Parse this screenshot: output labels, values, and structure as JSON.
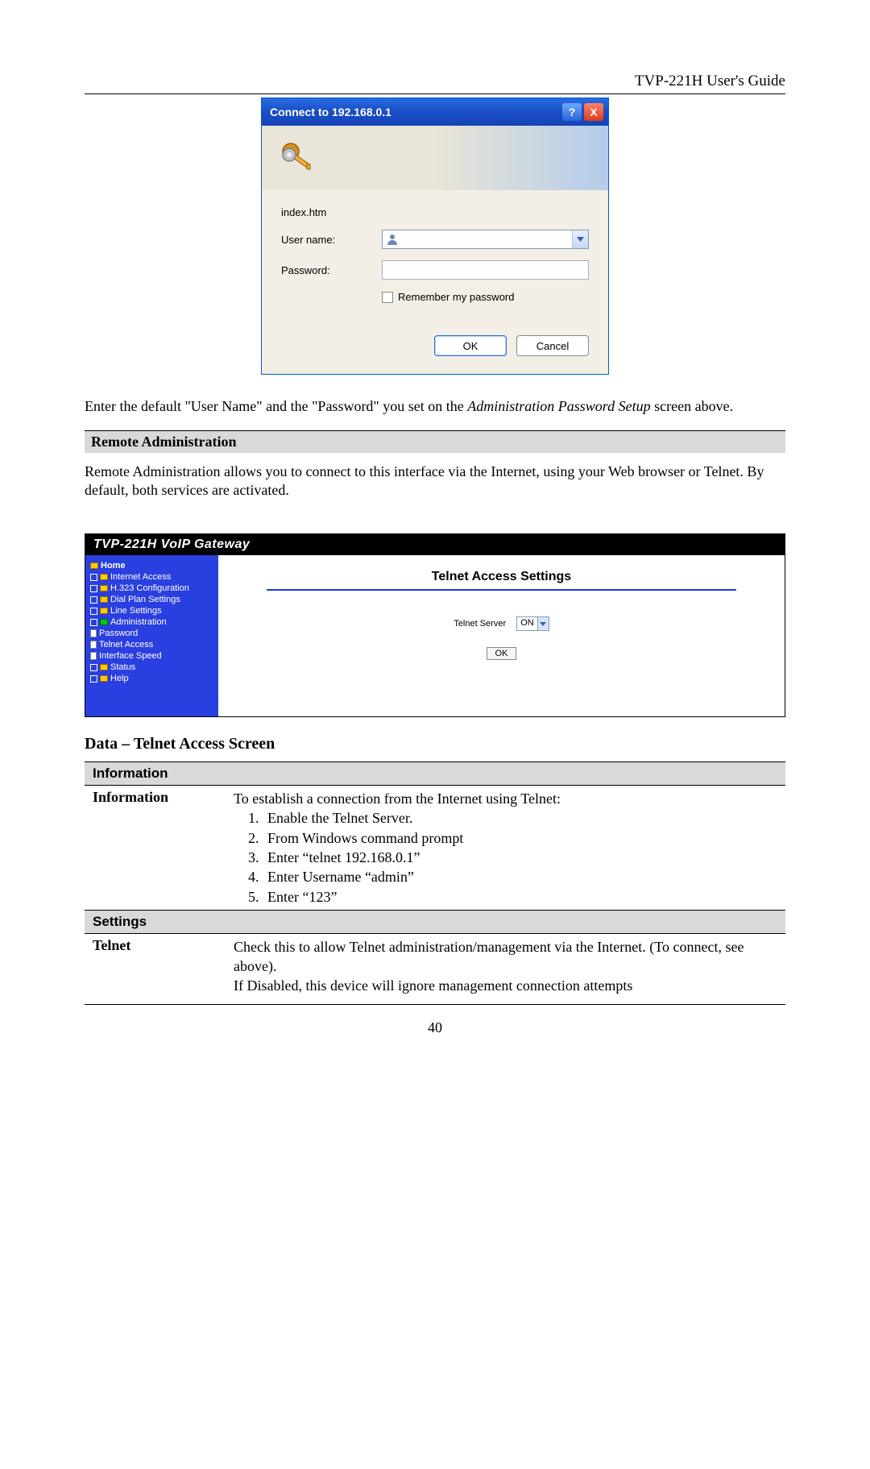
{
  "header": {
    "title": "TVP-221H User's Guide"
  },
  "dialog": {
    "title": "Connect to 192.168.0.1",
    "realm": "index.htm",
    "username_label": "User name:",
    "password_label": "Password:",
    "remember_label": "Remember my password",
    "ok_label": "OK",
    "cancel_label": "Cancel"
  },
  "para_intro_1": "Enter the default \"User Name\" and  the \"Password\" you set on the ",
  "para_intro_italic": "Administration Password Setup",
  "para_intro_2": " screen above.",
  "section_remote_admin": "Remote Administration",
  "para_remote": "Remote Administration allows you to connect to this interface via the Internet, using your Web browser or Telnet. By default, both services are activated.",
  "gateway": {
    "title": "TVP-221H VoIP Gateway",
    "nav": {
      "home": "Home",
      "internet": "Internet Access",
      "h323": "H.323 Configuration",
      "dial": "Dial Plan Settings",
      "line": "Line Settings",
      "admin": "Administration",
      "password": "Password",
      "telnet": "Telnet Access",
      "speed": "Interface Speed",
      "status": "Status",
      "help": "Help"
    },
    "main": {
      "title": "Telnet Access Settings",
      "server_label": "Telnet Server",
      "server_value": "ON",
      "ok_label": "OK"
    }
  },
  "subheading_data": "Data – Telnet Access Screen",
  "table": {
    "info_head": "Information",
    "info_key": "Information",
    "info_intro": "To establish a connection from the Internet  using Telnet:",
    "info_steps": {
      "s1": "Enable the Telnet Server.",
      "s2": "From Windows command prompt",
      "s3": "Enter “telnet 192.168.0.1”",
      "s4": "Enter Username “admin”",
      "s5": "Enter “123”"
    },
    "settings_head": "Settings",
    "telnet_key": "Telnet",
    "telnet_val_1": "Check this to allow Telnet administration/management via the Internet. (To connect, see above).",
    "telnet_val_2": "If Disabled, this device will ignore management connection attempts"
  },
  "page_number": "40"
}
